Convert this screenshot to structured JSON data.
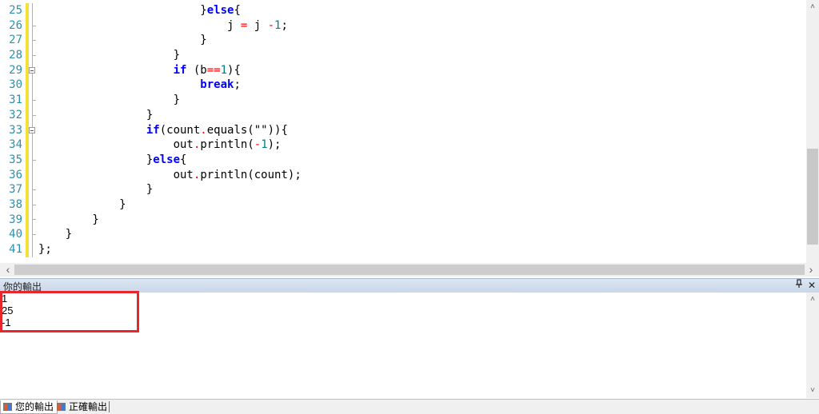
{
  "editor": {
    "line_numbers": [
      "25",
      "26",
      "27",
      "28",
      "29",
      "30",
      "31",
      "32",
      "33",
      "34",
      "35",
      "36",
      "37",
      "38",
      "39",
      "40",
      "41"
    ],
    "lines": [
      [
        {
          "t": "                        }"
        },
        {
          "t": "else",
          "c": "kw"
        },
        {
          "t": "{"
        }
      ],
      [
        {
          "t": "                            j "
        },
        {
          "t": "=",
          "c": "op"
        },
        {
          "t": " j "
        },
        {
          "t": "-",
          "c": "op"
        },
        {
          "t": "1",
          "c": "num"
        },
        {
          "t": ";"
        }
      ],
      [
        {
          "t": "                        }"
        }
      ],
      [
        {
          "t": "                    }"
        }
      ],
      [
        {
          "t": "                    "
        },
        {
          "t": "if",
          "c": "kw"
        },
        {
          "t": " (b"
        },
        {
          "t": "==",
          "c": "op"
        },
        {
          "t": "1",
          "c": "num"
        },
        {
          "t": "){"
        }
      ],
      [
        {
          "t": "                        "
        },
        {
          "t": "break",
          "c": "kw"
        },
        {
          "t": ";"
        }
      ],
      [
        {
          "t": "                    }"
        }
      ],
      [
        {
          "t": "                }"
        }
      ],
      [
        {
          "t": "                "
        },
        {
          "t": "if",
          "c": "kw"
        },
        {
          "t": "(count"
        },
        {
          "t": ".",
          "c": "op"
        },
        {
          "t": "equals(\"\")){"
        }
      ],
      [
        {
          "t": "                    out"
        },
        {
          "t": ".",
          "c": "op"
        },
        {
          "t": "println("
        },
        {
          "t": "-",
          "c": "op"
        },
        {
          "t": "1",
          "c": "num"
        },
        {
          "t": ");"
        }
      ],
      [
        {
          "t": "                }"
        },
        {
          "t": "else",
          "c": "kw"
        },
        {
          "t": "{"
        }
      ],
      [
        {
          "t": "                    out"
        },
        {
          "t": ".",
          "c": "op"
        },
        {
          "t": "println(count);"
        }
      ],
      [
        {
          "t": "                }"
        }
      ],
      [
        {
          "t": "            }"
        }
      ],
      [
        {
          "t": "        }"
        }
      ],
      [
        {
          "t": "    }"
        }
      ],
      [
        {
          "t": "};"
        }
      ]
    ]
  },
  "scroll": {
    "left_arrow": "‹",
    "right_arrow": "›",
    "up_arrow": "˄",
    "down_arrow": "˅"
  },
  "output_panel": {
    "title": "你的輸出",
    "pin_icon": "pin-icon",
    "close_label": "✕",
    "pin_label": "ᵖ",
    "lines": [
      "1",
      "25",
      "-1"
    ],
    "highlight_color": "#e8262b"
  },
  "tabs": [
    {
      "label": "您的輸出",
      "active": true
    },
    {
      "label": "正確輸出",
      "active": false
    }
  ]
}
